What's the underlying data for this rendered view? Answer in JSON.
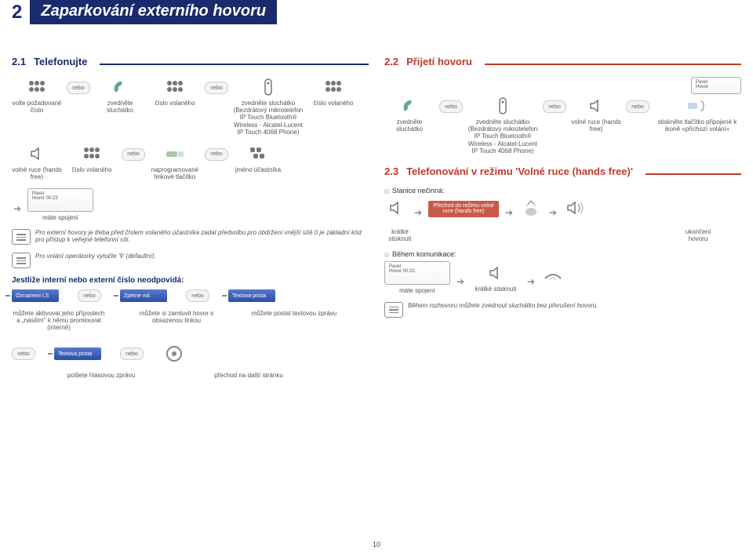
{
  "chapter": {
    "num": "2",
    "title": "Zaparkování externího hovoru"
  },
  "s21": {
    "num": "2.1",
    "title": "Telefonujte"
  },
  "s22": {
    "num": "2.2",
    "title": "Přijetí hovoru"
  },
  "s23": {
    "num": "2.3",
    "title": "Telefonování v režimu 'Volné ruce (hands free)'"
  },
  "nebo": "nebo",
  "left": {
    "r1": {
      "dial": "volte požadované číslo",
      "lift": "zvedněte sluchátko",
      "num": "číslo volaného",
      "bt": "zvedněte sluchátko (Bezdrátový mikrotelefon IP Touch Bluetooth® Wireless - Alcatel-Lucent IP Touch 4068 Phone)",
      "num2": "číslo volaného"
    },
    "r2": {
      "hf": "volné ruce (hands free)",
      "num": "číslo volaného",
      "prog": "naprogramované linkové tlačítko",
      "name": "jméno účastníka"
    },
    "display": {
      "name": "Pavel",
      "detail": "Hovor 00:23"
    },
    "connected": "máte spojení",
    "tip1": "Pro externí hovory je třeba před číslem volaného účastníka zadat předvolbu pro obdržení vnější sítě 0 je základní kód pro přístup k veřejné telefonní síti.",
    "tip2": "Pro volání operátorky vytočte '9' (defaultní).",
    "noanswer": "Jestliže interní nebo externí číslo neodpovídá:",
    "sk1": "Oznameni LS",
    "sk2": "Zpetne vol.",
    "sk3": "Textova posta",
    "opt1": "můžete aktivovat jeho příposlech a „násilím\" k němu promlouvat (interně)",
    "opt2": "můžete si zamluvit hovor s obsazenou linkou",
    "opt3": "můžete poslat textovou zprávu",
    "sk4": "Textova posta",
    "opt4": "pošlete hlasovou zprávu",
    "opt5": "přechod na další stránku"
  },
  "right": {
    "r1": {
      "lift": "zvedněte sluchátko",
      "bt": "zvedněte sluchátko (Bezdrátový mikrotelefon IP Touch Bluetooth® Wireless - Alcatel-Lucent IP Touch 4068 Phone)",
      "hf": "volné ruce (hands free)",
      "line": "stiskněte tlačítko připojené k ikoně «příchozí volání»"
    },
    "displayName": "Pavel",
    "displayHovor": "Hovor",
    "idle": "Stanice nečinná:",
    "redbox": "Přechod do režimu volné ruce (hands free)",
    "short": "krátké stisknutí",
    "endcall": "ukončení hovoru",
    "during": "Během komunikace:",
    "display2": {
      "name": "Pavel",
      "detail": "Hovor 00:23"
    },
    "connected": "máte spojení",
    "short2": "krátké stisknutí",
    "tip": "Během rozhovoru můžete zvednout sluchátko bez přerušení hovoru."
  },
  "pagenum": "10"
}
